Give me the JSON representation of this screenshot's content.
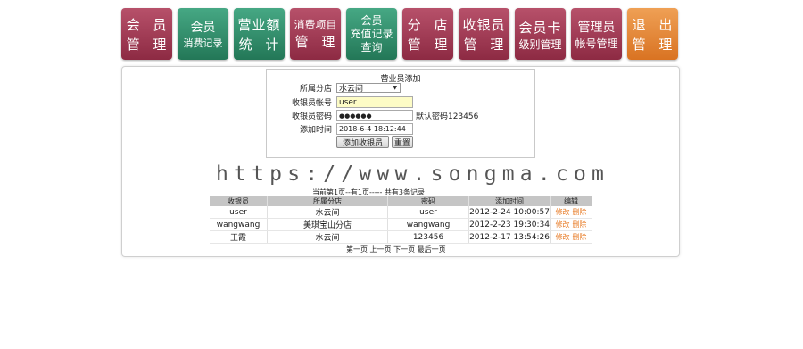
{
  "nav": [
    {
      "line1": "会 员",
      "line2": "管 理",
      "style1": "big",
      "style2": "big",
      "color": "red"
    },
    {
      "line1": "会员",
      "line2": "消费记录",
      "style1": "mid",
      "style2": "sm",
      "color": "green"
    },
    {
      "line1": "营业额",
      "line2": "统 计",
      "style1": "big",
      "style2": "big",
      "color": "green"
    },
    {
      "line1": "消费项目",
      "line2": "管 理",
      "style1": "sm",
      "style2": "big",
      "color": "red"
    },
    {
      "line1": "会员",
      "line2": "充值记录",
      "line3": "查询",
      "color": "green"
    },
    {
      "line1": "分 店",
      "line2": "管 理",
      "style1": "big",
      "style2": "big",
      "color": "red"
    },
    {
      "line1": "收银员",
      "line2": "管 理",
      "style1": "big",
      "style2": "big",
      "color": "red"
    },
    {
      "line1": "会员卡",
      "line2": "级别管理",
      "style1": "big",
      "style2": "sm",
      "color": "red"
    },
    {
      "line1": "管理员",
      "line2": "帐号管理",
      "style1": "mid",
      "style2": "sm",
      "color": "red"
    },
    {
      "line1": "退 出",
      "line2": "管 理",
      "style1": "big",
      "style2": "big",
      "color": "orange"
    }
  ],
  "form": {
    "title": "营业员添加",
    "branch_label": "所属分店",
    "branch_value": "水云间",
    "account_label": "收银员帐号",
    "account_value": "user",
    "password_label": "收银员密码",
    "password_value": "●●●●●●",
    "password_hint": "默认密码123456",
    "time_label": "添加时间",
    "time_value": "2018-6-4 18:12:44",
    "add_button": "添加收银员",
    "reset_button": "重置"
  },
  "watermark": "https://www.songma.com",
  "pager_top": "当前第1页--有1页----- 共有3条记录",
  "table": {
    "headers": [
      "收银员",
      "所属分店",
      "密码",
      "添加时间",
      "编辑"
    ],
    "rows": [
      {
        "name": "user",
        "branch": "水云间",
        "password": "user",
        "time": "2012-2-24 10:00:57",
        "edit": "修改",
        "delete": "删除"
      },
      {
        "name": "wangwang",
        "branch": "美琪宝山分店",
        "password": "wangwang",
        "time": "2012-2-23 19:30:34",
        "edit": "修改",
        "delete": "删除"
      },
      {
        "name": "王霞",
        "branch": "水云间",
        "password": "123456",
        "time": "2012-2-17 13:54:26",
        "edit": "修改",
        "delete": "删除"
      }
    ]
  },
  "pager_bottom": "第一页 上一页 下一页 最后一页",
  "colors": {
    "tile_red": "#9c3450",
    "tile_green": "#2f8a66",
    "tile_orange": "#e4852c",
    "input_yellow": "#fdfcc6",
    "link_orange": "#e87b25"
  }
}
